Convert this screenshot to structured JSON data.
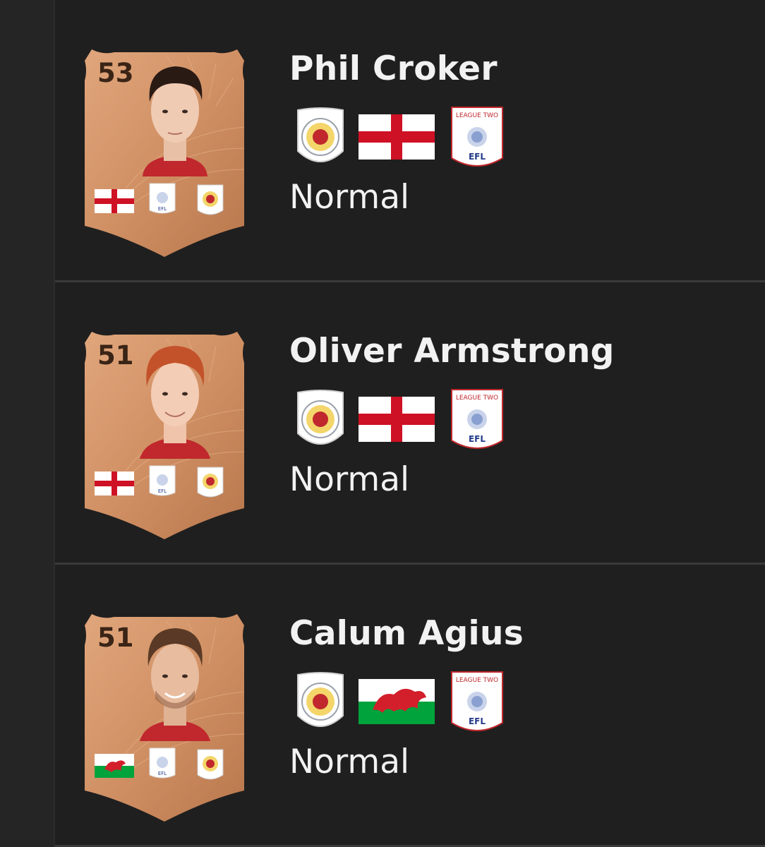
{
  "players": [
    {
      "name": "Phil Croker",
      "rating": "53",
      "type": "Normal",
      "nation": "england",
      "hair": "dark"
    },
    {
      "name": "Oliver Armstrong",
      "rating": "51",
      "type": "Normal",
      "nation": "england",
      "hair": "ginger"
    },
    {
      "name": "Calum Agius",
      "rating": "51",
      "type": "Normal",
      "nation": "wales",
      "hair": "brown"
    }
  ],
  "colors": {
    "background": "#1f1f1f",
    "card": "#d4956a",
    "card_dark": "#b9774c",
    "text": "#f2f2f2",
    "rating": "#3a2416"
  },
  "league": {
    "label_top": "LEAGUE TWO",
    "label_bottom": "EFL"
  },
  "club": {
    "icon": "crewe-alexandra-crest-icon"
  }
}
